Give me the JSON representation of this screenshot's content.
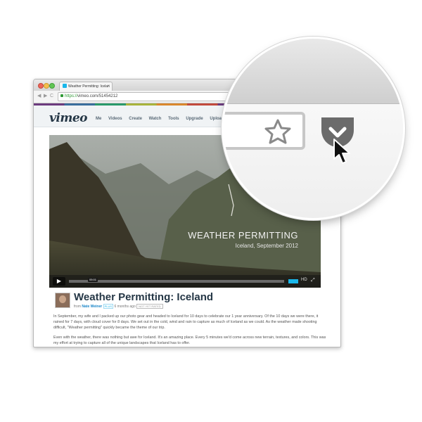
{
  "browser": {
    "tab_title": "Weather Permitting: Icelan",
    "tab_close": "×",
    "url_scheme": "https://",
    "url_rest": "vimeo.com/51454212",
    "nav_back": "◀",
    "nav_forward": "▶",
    "nav_reload": "C"
  },
  "site": {
    "logo": "vimeo",
    "nav": [
      "Me",
      "Videos",
      "Create",
      "Watch",
      "Tools",
      "Upgrade",
      "Upload"
    ]
  },
  "video": {
    "overlay_title": "WEATHER PERMITTING",
    "overlay_subtitle": "Iceland, September 2012",
    "time": "05:01",
    "progress": 0.0,
    "hd_label": "HD"
  },
  "page": {
    "title": "Weather Permitting: Iceland",
    "byline_from": "from",
    "author": "Nate Weiner",
    "plus_badge": "PLUS",
    "posted": "6 months ago",
    "rating": "NOT YET RATED",
    "description": [
      "In September, my wife and I packed up our photo gear and headed to Iceland for 10 days to celebrate our 1 year anniversary. Of the 10 days we were there, it rained for 7 days, with cloud cover for 8 days. We set out in the cold, wind and rain to capture as much of Iceland as we could. As the weather made shooting difficult, \"Weather permitting\" quickly became the theme of our trip.",
      "Even with the weather, there was nothing but awe for Iceland. It's an amazing place. Every 5 minutes we'd come across new terrain, textures, and colors. This was my effort at trying to capture all of the unique landscapes that Iceland has to offer."
    ]
  },
  "icons": {
    "star": "star-icon",
    "pocket": "pocket-icon",
    "cursor": "cursor-icon"
  },
  "colors": {
    "vimeo_blue": "#1ab7ea",
    "pocket_gray": "#6b6b6b",
    "title_navy": "#253746"
  }
}
